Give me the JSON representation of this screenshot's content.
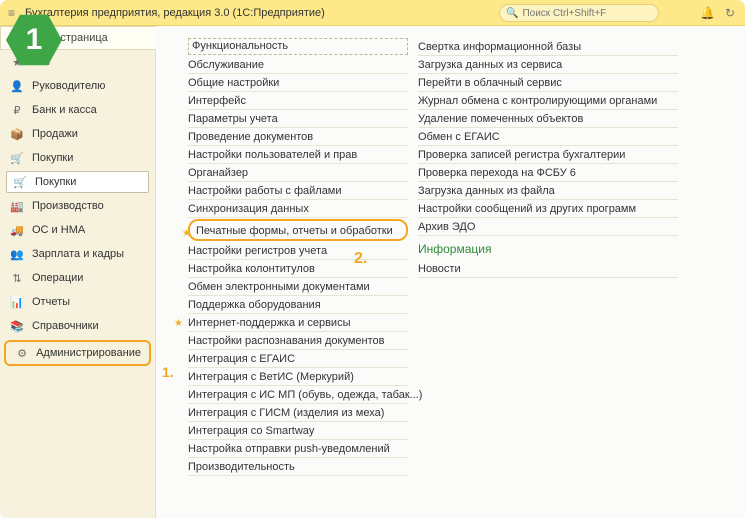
{
  "titlebar": {
    "app_title": "Бухгалтерия предприятия, редакция 3.0  (1С:Предприятие)",
    "search_placeholder": "Поиск Ctrl+Shift+F"
  },
  "badge": {
    "number": "1"
  },
  "callouts": {
    "one": "1.",
    "two": "2."
  },
  "sidebar": {
    "toptab": "льная страница",
    "items": [
      {
        "icon": "★",
        "label": "ное"
      },
      {
        "icon": "👤",
        "label": "Руководителю"
      },
      {
        "icon": "₽",
        "label": "Банк и касса"
      },
      {
        "icon": "📦",
        "label": "Продажи"
      },
      {
        "icon": "🛒",
        "label": "Покупки",
        "selected": true
      },
      {
        "icon": "🛒",
        "label": "Покупки"
      },
      {
        "icon": "🏭",
        "label": "Производство"
      },
      {
        "icon": "🚚",
        "label": "ОС и НМА"
      },
      {
        "icon": "👥",
        "label": "Зарплата и кадры"
      },
      {
        "icon": "⇅",
        "label": "Операции"
      },
      {
        "icon": "📊",
        "label": "Отчеты"
      },
      {
        "icon": "📚",
        "label": "Справочники"
      },
      {
        "icon": "⚙",
        "label": "Администрирование",
        "highlight": true
      }
    ]
  },
  "main": {
    "left": [
      "Функциональность",
      "Обслуживание",
      "Общие настройки",
      "Интерфейс",
      "Параметры учета",
      "Проведение документов",
      "Настройки пользователей и прав",
      "Органайзер",
      "Настройки работы с файлами",
      "Синхронизация данных",
      "Печатные формы, отчеты и обработки",
      "Настройки регистров учета",
      "Настройка колонтитулов",
      "Обмен электронными документами",
      "Поддержка оборудования",
      "Интернет-поддержка и сервисы",
      "Настройки распознавания документов",
      "Интеграция с ЕГАИС",
      "Интеграция с ВетИС (Меркурий)",
      "Интеграция с ИС МП (обувь, одежда, табак...)",
      "Интеграция с ГИСМ (изделия из меха)",
      "Интеграция со Smartway",
      "Настройка отправки push-уведомлений",
      "Производительность"
    ],
    "right_links": [
      "Свертка информационной базы",
      "Загрузка данных из сервиса",
      "Перейти в облачный сервис",
      "Журнал обмена с контролирующими органами",
      "Удаление помеченных объектов",
      "Обмен с ЕГАИС",
      "Проверка записей регистра бухгалтерии",
      "Проверка перехода на ФСБУ 6",
      "Загрузка данных из файла",
      "Настройки сообщений из других программ",
      "Архив ЭДО"
    ],
    "right_section": "Информация",
    "right_info": [
      "Новости"
    ]
  }
}
